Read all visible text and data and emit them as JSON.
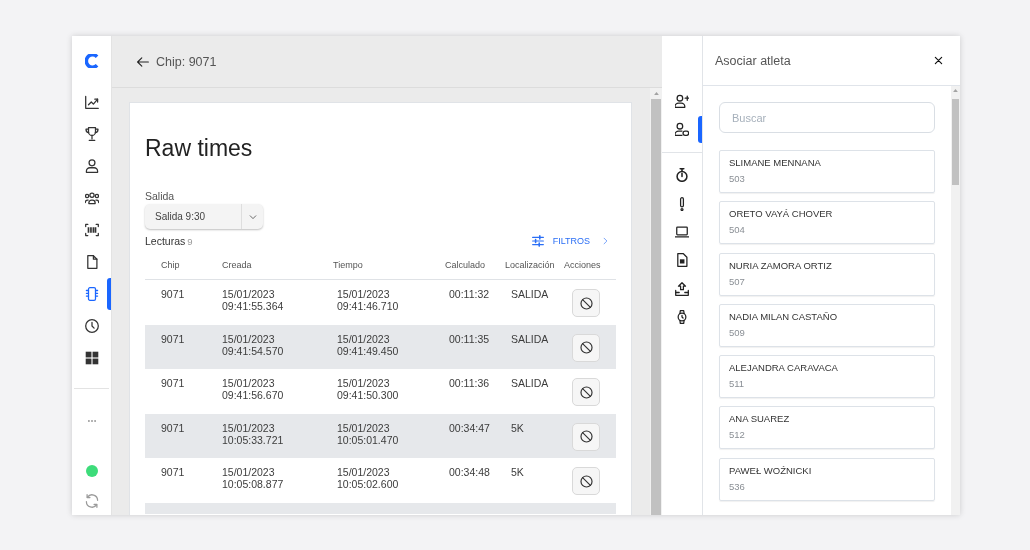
{
  "sidebar": {
    "items": [
      {
        "selected": false
      },
      {
        "selected": false
      },
      {
        "selected": false
      },
      {
        "selected": false
      },
      {
        "selected": false
      },
      {
        "selected": false
      },
      {
        "selected": true
      },
      {
        "selected": false
      },
      {
        "selected": false
      }
    ],
    "connected": true
  },
  "header": {
    "title": "Chip: 9071"
  },
  "card": {
    "title": "Raw times",
    "select": {
      "label": "Salida",
      "value": "Salida 9:30"
    },
    "readings": {
      "label": "Lecturas",
      "count": "9"
    },
    "filter_button": "FILTROS"
  },
  "table": {
    "columns": [
      "Chip",
      "Creada",
      "Tiempo",
      "Calculado",
      "Localización",
      "Acciones"
    ],
    "rows": [
      {
        "chip": "9071",
        "created": "15/01/2023 09:41:55.364",
        "time": "15/01/2023 09:41:46.710",
        "calculated": "00:11:32",
        "location": "SALIDA"
      },
      {
        "chip": "9071",
        "created": "15/01/2023 09:41:54.570",
        "time": "15/01/2023 09:41:49.450",
        "calculated": "00:11:35",
        "location": "SALIDA"
      },
      {
        "chip": "9071",
        "created": "15/01/2023 09:41:56.670",
        "time": "15/01/2023 09:41:50.300",
        "calculated": "00:11:36",
        "location": "SALIDA"
      },
      {
        "chip": "9071",
        "created": "15/01/2023 10:05:33.721",
        "time": "15/01/2023 10:05:01.470",
        "calculated": "00:34:47",
        "location": "5K"
      },
      {
        "chip": "9071",
        "created": "15/01/2023 10:05:08.877",
        "time": "15/01/2023 10:05:02.600",
        "calculated": "00:34:48",
        "location": "5K"
      }
    ]
  },
  "tool_rail": {
    "groups": [
      {
        "items": [
          {
            "selected": false
          },
          {
            "selected": true
          }
        ]
      },
      {
        "items": [
          {
            "selected": false
          },
          {
            "selected": false
          },
          {
            "selected": false
          },
          {
            "selected": false
          },
          {
            "selected": false
          },
          {
            "selected": false
          }
        ]
      }
    ]
  },
  "panel": {
    "title": "Asociar atleta",
    "search": {
      "placeholder": "Buscar"
    },
    "athletes": [
      {
        "name": "SLIMANE MENNANA",
        "bib": "503"
      },
      {
        "name": "ORETO VAYÁ CHOVER",
        "bib": "504"
      },
      {
        "name": "NURIA ZAMORA ORTIZ",
        "bib": "507"
      },
      {
        "name": "NADIA MILAN CASTAÑO",
        "bib": "509"
      },
      {
        "name": "ALEJANDRA CARAVACA",
        "bib": "511"
      },
      {
        "name": "ANA SUAREZ",
        "bib": "512"
      },
      {
        "name": "PAWEŁ WOŹNICKI",
        "bib": "536"
      }
    ]
  }
}
